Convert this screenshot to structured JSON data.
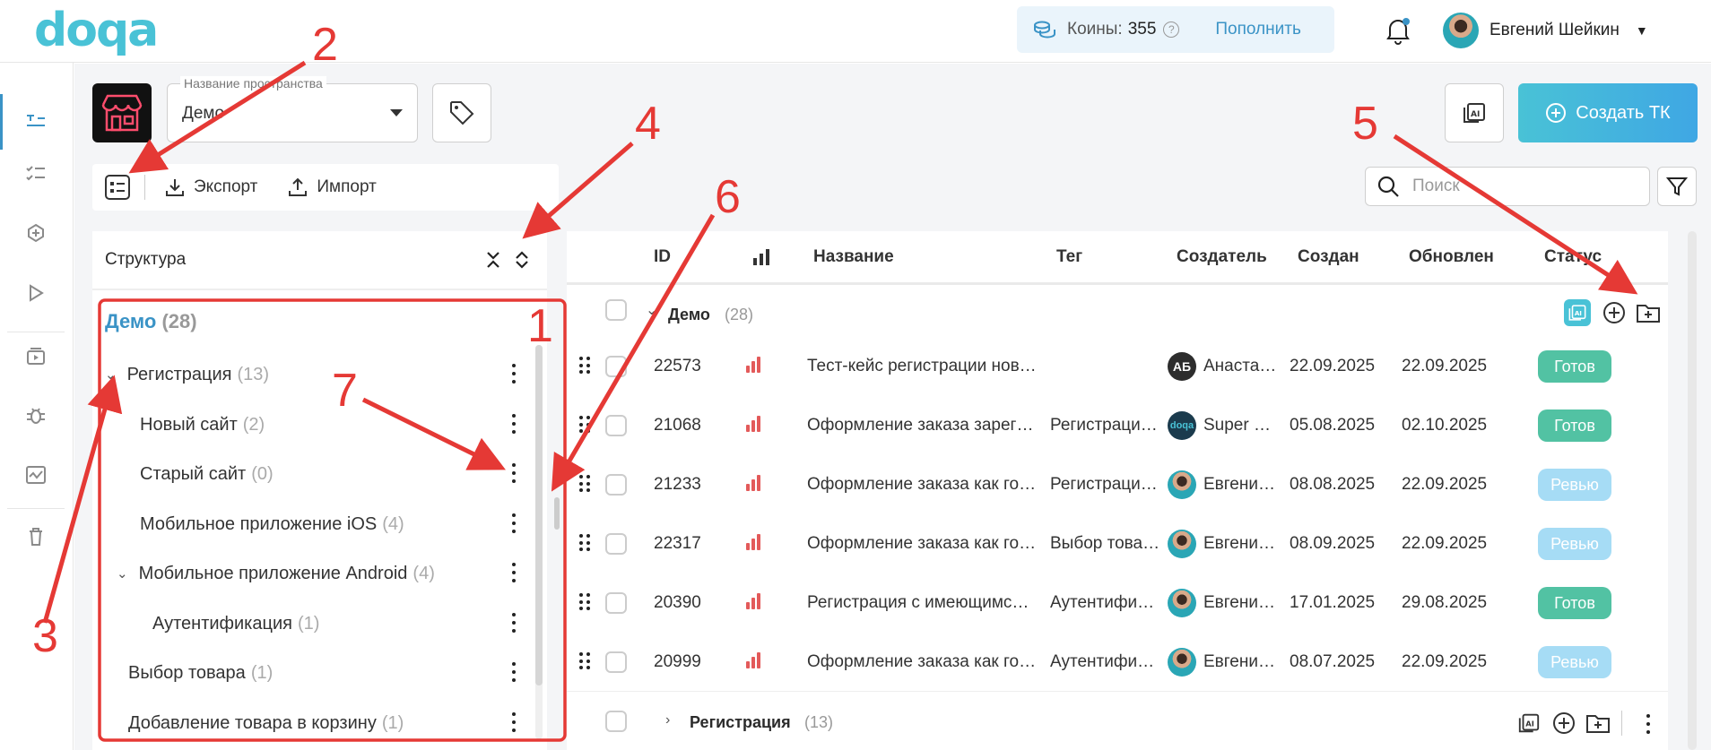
{
  "app": {
    "logo": "doqa"
  },
  "topbar": {
    "coins_label": "Коины:",
    "coins_value": "355",
    "help": "?",
    "topup_label": "Пополнить",
    "user_name": "Евгений Шейкин"
  },
  "space": {
    "field_label": "Название пространства",
    "value": "Демо"
  },
  "actions": {
    "create_tc": "Создать ТК"
  },
  "toolbar": {
    "export": "Экспорт",
    "import": "Импорт",
    "search_placeholder": "Поиск"
  },
  "structure": {
    "title": "Структура",
    "root": {
      "label": "Демо",
      "count": "(28)"
    },
    "items": [
      {
        "label": "Регистрация",
        "count": "(13)"
      },
      {
        "label": "Новый сайт",
        "count": "(2)"
      },
      {
        "label": "Старый сайт",
        "count": "(0)"
      },
      {
        "label": "Мобильное приложение iOS",
        "count": "(4)"
      },
      {
        "label": "Мобильное приложение Android",
        "count": "(4)"
      },
      {
        "label": "Аутентификация",
        "count": "(1)"
      },
      {
        "label": "Выбор товара",
        "count": "(1)"
      },
      {
        "label": "Добавление товара в корзину",
        "count": "(1)"
      }
    ]
  },
  "table": {
    "headers": {
      "id": "ID",
      "name": "Название",
      "tag": "Тег",
      "creator": "Создатель",
      "created": "Создан",
      "updated": "Обновлен",
      "status": "Статус"
    },
    "groups": [
      {
        "label": "Демо",
        "count": "(28)"
      },
      {
        "label": "Регистрация",
        "count": "(13)"
      }
    ],
    "rows": [
      {
        "id": "22573",
        "name": "Тест-кейс регистрации нов…",
        "tag": "",
        "creator": "Анаста…",
        "initials": "АБ",
        "created": "22.09.2025",
        "updated": "22.09.2025",
        "status": "Готов"
      },
      {
        "id": "21068",
        "name": "Оформление заказа зарег…",
        "tag": "Регистраци…",
        "creator": "Super …",
        "initials": "doqa",
        "created": "05.08.2025",
        "updated": "02.10.2025",
        "status": "Готов"
      },
      {
        "id": "21233",
        "name": "Оформление заказа как го…",
        "tag": "Регистраци…",
        "creator": "Евгени…",
        "initials": "",
        "created": "08.08.2025",
        "updated": "22.09.2025",
        "status": "Ревью"
      },
      {
        "id": "22317",
        "name": "Оформление заказа как го…",
        "tag": "Выбор това…",
        "creator": "Евгени…",
        "initials": "",
        "created": "08.09.2025",
        "updated": "22.09.2025",
        "status": "Ревью"
      },
      {
        "id": "20390",
        "name": "Регистрация с имеющимс…",
        "tag": "Аутентифи…",
        "creator": "Евгени…",
        "initials": "",
        "created": "17.01.2025",
        "updated": "29.08.2025",
        "status": "Готов"
      },
      {
        "id": "20999",
        "name": "Оформление заказа как го…",
        "tag": "Аутентифи…",
        "creator": "Евгени…",
        "initials": "",
        "created": "08.07.2025",
        "updated": "22.09.2025",
        "status": "Ревью"
      }
    ]
  },
  "colors": {
    "accent": "#3a93c6",
    "ready": "#52c2a3",
    "review": "#a6dcf5",
    "annotation": "#e53935"
  },
  "annotations": {
    "n1": "1",
    "n2": "2",
    "n3": "3",
    "n4": "4",
    "n5": "5",
    "n6": "6",
    "n7": "7"
  }
}
